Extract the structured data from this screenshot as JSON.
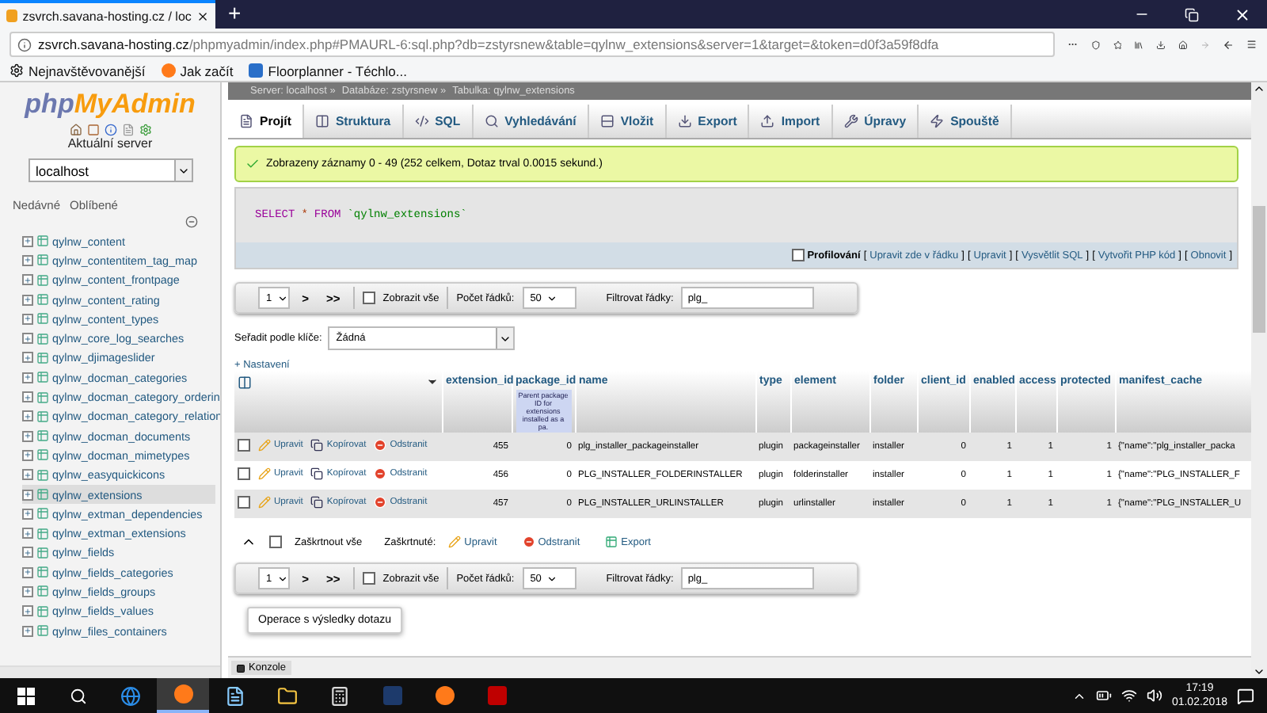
{
  "browser": {
    "tab_title": "zsvrch.savana-hosting.cz / loc",
    "new_tab": "+",
    "url_host": "zsvrch.savana-hosting.cz",
    "url_path": "/phpmyadmin/index.php#PMAURL-6:sql.php?db=zstyrsnew&table=qylnw_extensions&server=1&target=&token=d0f3a59f8dfa",
    "bookmarks": [
      {
        "kind": "gear",
        "label": "Nejnavštěvovanější"
      },
      {
        "kind": "firefox",
        "label": "Jak začít"
      },
      {
        "kind": "site",
        "label": "Floorplanner - Téchlo..."
      }
    ]
  },
  "sidebar": {
    "logo_php": "php",
    "logo_rest": "MyAdmin",
    "server_label": "Aktuální server",
    "server": "localhost",
    "links": [
      "Nedávné",
      "Oblíbené"
    ],
    "tables": [
      {
        "label": "qylnw_content",
        "selected": false
      },
      {
        "label": "qylnw_contentitem_tag_map",
        "selected": false
      },
      {
        "label": "qylnw_content_frontpage",
        "selected": false
      },
      {
        "label": "qylnw_content_rating",
        "selected": false
      },
      {
        "label": "qylnw_content_types",
        "selected": false
      },
      {
        "label": "qylnw_core_log_searches",
        "selected": false
      },
      {
        "label": "qylnw_djimageslider",
        "selected": false
      },
      {
        "label": "qylnw_docman_categories",
        "selected": false
      },
      {
        "label": "qylnw_docman_category_orderin",
        "selected": false
      },
      {
        "label": "qylnw_docman_category_relation",
        "selected": false
      },
      {
        "label": "qylnw_docman_documents",
        "selected": false
      },
      {
        "label": "qylnw_docman_mimetypes",
        "selected": false
      },
      {
        "label": "qylnw_easyquickicons",
        "selected": false
      },
      {
        "label": "qylnw_extensions",
        "selected": true
      },
      {
        "label": "qylnw_extman_dependencies",
        "selected": false
      },
      {
        "label": "qylnw_extman_extensions",
        "selected": false
      },
      {
        "label": "qylnw_fields",
        "selected": false
      },
      {
        "label": "qylnw_fields_categories",
        "selected": false
      },
      {
        "label": "qylnw_fields_groups",
        "selected": false
      },
      {
        "label": "qylnw_fields_values",
        "selected": false
      },
      {
        "label": "qylnw_files_containers",
        "selected": false
      }
    ]
  },
  "breadcrumb": [
    "Server: localhost »",
    "Databáze: zstyrsnew »",
    "Tabulka: qylnw_extensions"
  ],
  "tabs": [
    {
      "label": "Projít",
      "selected": true
    },
    {
      "label": "Struktura",
      "selected": false
    },
    {
      "label": "SQL",
      "selected": false
    },
    {
      "label": "Vyhledávání",
      "selected": false
    },
    {
      "label": "Vložit",
      "selected": false
    },
    {
      "label": "Export",
      "selected": false
    },
    {
      "label": "Import",
      "selected": false
    },
    {
      "label": "Úpravy",
      "selected": false
    },
    {
      "label": "Spouště",
      "selected": false
    }
  ],
  "message": "Zobrazeny záznamy 0 - 49 (252 celkem, Dotaz trval 0.0015 sekund.)",
  "sql": {
    "select": "SELECT",
    "star": "*",
    "from": "FROM",
    "table": "`qylnw_extensions`"
  },
  "profiling": {
    "label": "Profilování",
    "checked": false,
    "bracket_open": "[",
    "bracket_close": "]",
    "links": [
      "Upravit zde v řádku",
      "Upravit",
      "Vysvětlit SQL",
      "Vytvořit PHP kód",
      "Obnovit"
    ]
  },
  "navigators": [
    {
      "page": "1",
      "next": ">",
      "last": ">>",
      "show_all": "Zobrazit vše",
      "show_all_checked": false,
      "rows_label": "Počet řádků:",
      "rows": "50",
      "filter_label": "Filtrovat řádky:",
      "filter": "plg_"
    },
    {
      "page": "1",
      "next": ">",
      "last": ">>",
      "show_all": "Zobrazit vše",
      "show_all_checked": false,
      "rows_label": "Počet řádků:",
      "rows": "50",
      "filter_label": "Filtrovat řádky:",
      "filter": "plg_"
    }
  ],
  "sort": {
    "label": "Seřadit podle klíče:",
    "value": "Žádná"
  },
  "options_link": "+ Nastavení",
  "table": {
    "columns": [
      {
        "label": "extension_id"
      },
      {
        "label": "package_id",
        "note": "Parent package ID for extensions installed as a pa."
      },
      {
        "label": "name"
      },
      {
        "label": "type"
      },
      {
        "label": "element"
      },
      {
        "label": "folder"
      },
      {
        "label": "client_id"
      },
      {
        "label": "enabled"
      },
      {
        "label": "access"
      },
      {
        "label": "protected"
      },
      {
        "label": "manifest_cache"
      }
    ],
    "rows": [
      {
        "checked": false,
        "actions": [
          {
            "kind": "edit",
            "label": "Upravit"
          },
          {
            "kind": "copy",
            "label": "Kopírovat"
          },
          {
            "kind": "delete",
            "label": "Odstranit"
          }
        ],
        "cells": [
          "455",
          "0",
          "plg_installer_packageinstaller",
          "plugin",
          "packageinstaller",
          "installer",
          "0",
          "1",
          "1",
          "1",
          "{\"name\":\"plg_installer_packa"
        ]
      },
      {
        "checked": false,
        "actions": [
          {
            "kind": "edit",
            "label": "Upravit"
          },
          {
            "kind": "copy",
            "label": "Kopírovat"
          },
          {
            "kind": "delete",
            "label": "Odstranit"
          }
        ],
        "cells": [
          "456",
          "0",
          "PLG_INSTALLER_FOLDERINSTALLER",
          "plugin",
          "folderinstaller",
          "installer",
          "0",
          "1",
          "1",
          "1",
          "{\"name\":\"PLG_INSTALLER_F"
        ]
      },
      {
        "checked": false,
        "actions": [
          {
            "kind": "edit",
            "label": "Upravit"
          },
          {
            "kind": "copy",
            "label": "Kopírovat"
          },
          {
            "kind": "delete",
            "label": "Odstranit"
          }
        ],
        "cells": [
          "457",
          "0",
          "PLG_INSTALLER_URLINSTALLER",
          "plugin",
          "urlinstaller",
          "installer",
          "0",
          "1",
          "1",
          "1",
          "{\"name\":\"PLG_INSTALLER_U"
        ]
      }
    ]
  },
  "bulk": {
    "check_all": "Zaškrtnout vše",
    "check_all_checked": false,
    "with_selected": "Zaškrtnuté:",
    "actions": [
      {
        "kind": "edit",
        "label": "Upravit"
      },
      {
        "kind": "delete",
        "label": "Odstranit"
      },
      {
        "kind": "export",
        "label": "Export"
      }
    ]
  },
  "query_ops": "Operace s výsledky dotazu",
  "console": "Konzole",
  "taskbar": {
    "apps": [
      {
        "kind": "edge",
        "active": false
      },
      {
        "kind": "firefox",
        "active": true
      },
      {
        "kind": "notes",
        "active": false
      },
      {
        "kind": "folder",
        "active": false
      },
      {
        "kind": "calculator",
        "active": false
      },
      {
        "kind": "photoshop",
        "active": false
      },
      {
        "kind": "firefox",
        "active": false
      },
      {
        "kind": "filezilla",
        "active": false
      }
    ],
    "time": "17:19",
    "date": "01.02.2018"
  }
}
